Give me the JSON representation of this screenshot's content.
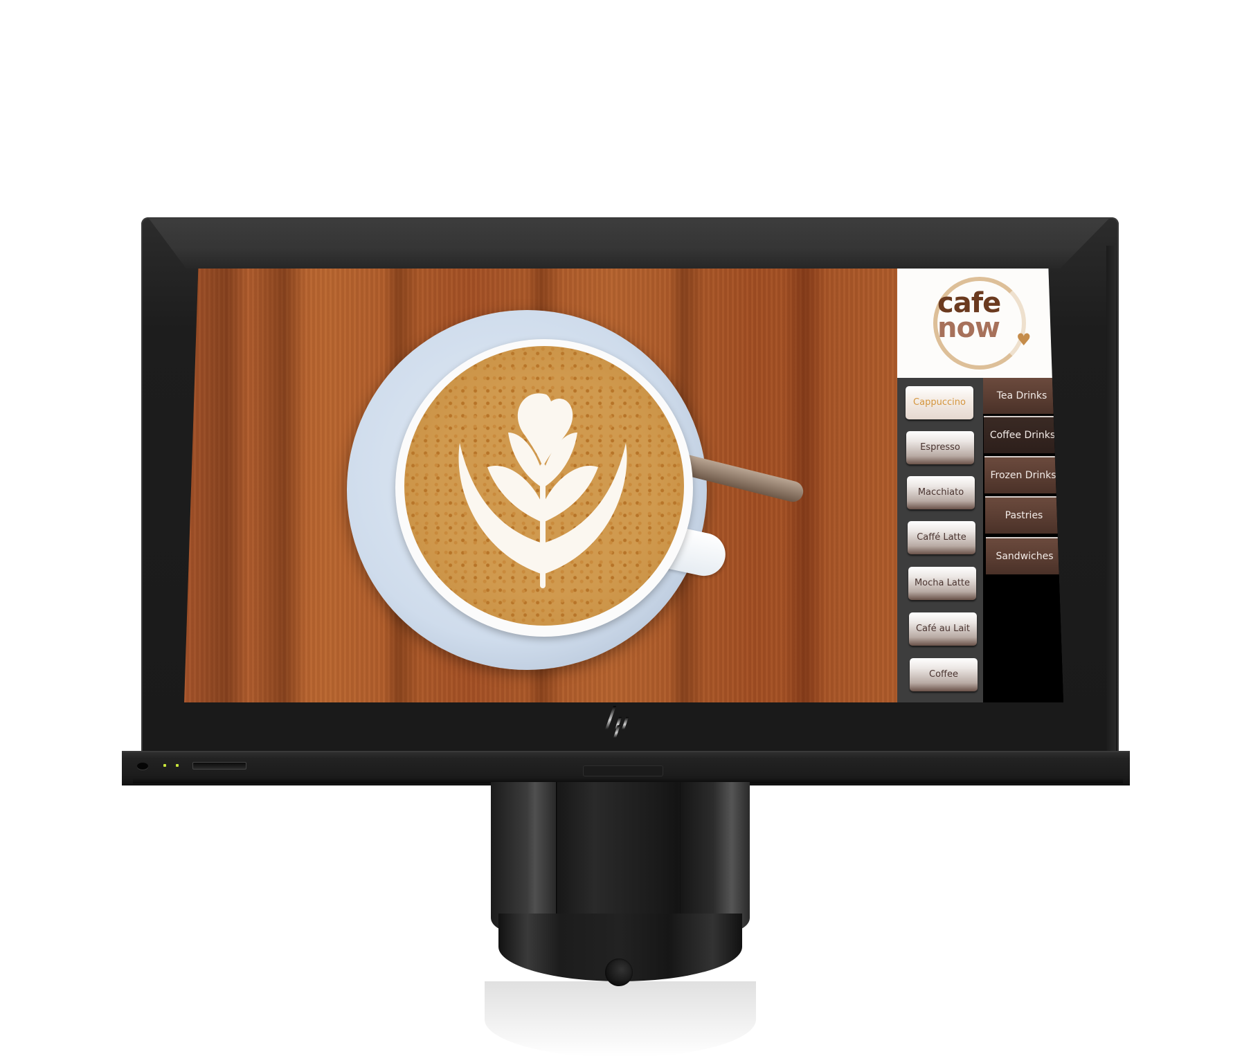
{
  "device": {
    "brand_logo": "hp-logo",
    "indicator_leds": 2,
    "led_color": "#c8e63a"
  },
  "app": {
    "brand": {
      "line1": "cafe",
      "line2": "now",
      "heart_icon": "heart-icon",
      "color_primary": "#6b3a1f",
      "color_secondary": "#a7715a"
    },
    "hero_image": "cappuccino-latte-art-on-wooden-table",
    "selected_drink": "Cappuccino",
    "active_category": "Coffee Drinks",
    "drinks": [
      {
        "label": "Cappuccino"
      },
      {
        "label": "Espresso"
      },
      {
        "label": "Macchiato"
      },
      {
        "label": "Caffé Latte"
      },
      {
        "label": "Mocha Latte"
      },
      {
        "label": "Café au Lait"
      },
      {
        "label": "Coffee"
      }
    ],
    "categories": [
      {
        "label": "Tea Drinks"
      },
      {
        "label": "Coffee Drinks"
      },
      {
        "label": "Frozen Drinks"
      },
      {
        "label": "Pastries"
      },
      {
        "label": "Sandwiches"
      }
    ],
    "colors": {
      "category_bg": "#5a3d32",
      "category_active_bg": "#2d1f1b",
      "drink_text": "#4a3430",
      "drink_selected_text": "#d4953d",
      "panel_bg": "#3d3d3d"
    }
  }
}
